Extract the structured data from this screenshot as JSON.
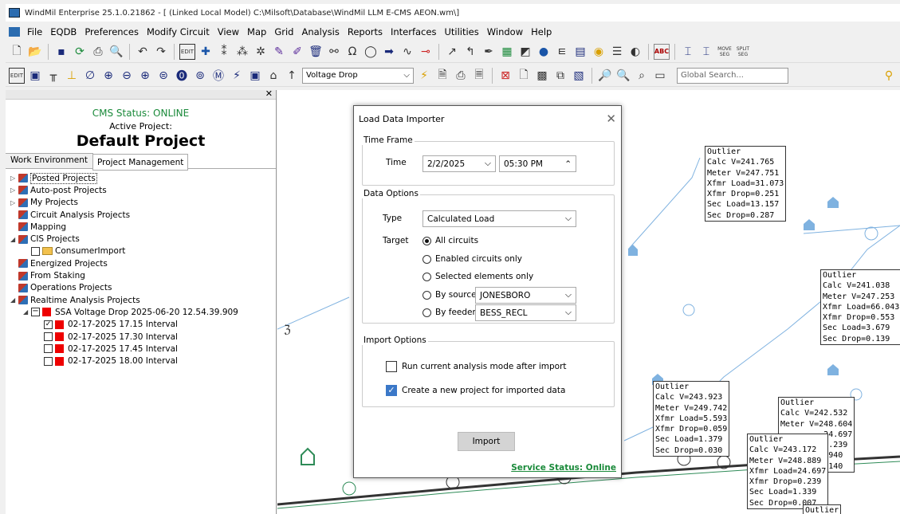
{
  "window": {
    "title": "WindMil Enterprise 25.1.0.21862 - [ (Linked Local Model) C:\\Milsoft\\Database\\WindMil LLM E-CMS AEON.wm\\]"
  },
  "menu": [
    "File",
    "EQDB",
    "Preferences",
    "Modify Circuit",
    "View",
    "Map",
    "Grid",
    "Analysis",
    "Reports",
    "Interfaces",
    "Utilities",
    "Window",
    "Help"
  ],
  "toolbar": {
    "mode_select": "Voltage Drop",
    "global_search_placeholder": "Global Search...",
    "edit_label": "EDIT",
    "move_label": "MOVE SEG",
    "split_label": "SPLIT SEG",
    "abc_label": "ABC"
  },
  "sidebar": {
    "status": "CMS Status: ONLINE",
    "active_label": "Active Project:",
    "project_name": "Default Project",
    "tabs": [
      "Work Environment",
      "Project Management"
    ],
    "tree": [
      {
        "label": "Posted Projects",
        "exp": "▷",
        "icon": "mix",
        "indent": 0
      },
      {
        "label": "Auto-post Projects",
        "exp": "▷",
        "icon": "mix",
        "indent": 0
      },
      {
        "label": "My Projects",
        "exp": "▷",
        "icon": "mix",
        "indent": 0
      },
      {
        "label": "Circuit Analysis Projects",
        "exp": "",
        "icon": "mix",
        "indent": 0
      },
      {
        "label": "Mapping",
        "exp": "",
        "icon": "mix",
        "indent": 0
      },
      {
        "label": "CIS Projects",
        "exp": "◢",
        "icon": "mix",
        "indent": 0
      },
      {
        "label": "ConsumerImport",
        "exp": "",
        "icon": "folder",
        "indent": 1
      },
      {
        "label": "Energized Projects",
        "exp": "",
        "icon": "mix",
        "indent": 0
      },
      {
        "label": "From Staking",
        "exp": "",
        "icon": "mix",
        "indent": 0
      },
      {
        "label": "Operations Projects",
        "exp": "",
        "icon": "mix",
        "indent": 0
      },
      {
        "label": "Realtime Analysis Projects",
        "exp": "◢",
        "icon": "mix",
        "indent": 0
      },
      {
        "label": "SSA Voltage Drop 2025-06-20 12.54.39.909",
        "exp": "◢",
        "icon": "minus",
        "indent": 1
      },
      {
        "label": "02-17-2025 17.15 Interval",
        "exp": "",
        "icon": "checked",
        "indent": 2
      },
      {
        "label": "02-17-2025 17.30 Interval",
        "exp": "",
        "icon": "check",
        "indent": 2
      },
      {
        "label": "02-17-2025 17.45 Interval",
        "exp": "",
        "icon": "check",
        "indent": 2
      },
      {
        "label": "02-17-2025 18.00 Interval",
        "exp": "",
        "icon": "check",
        "indent": 2
      }
    ]
  },
  "dialog": {
    "title": "Load Data Importer",
    "time_frame": "Time Frame",
    "time_label": "Time",
    "date": "2/2/2025",
    "time": "05:30 PM",
    "data_options": "Data Options",
    "type_label": "Type",
    "type_value": "Calculated Load",
    "target_label": "Target",
    "targets": [
      "All circuits",
      "Enabled circuits only",
      "Selected elements only",
      "By source",
      "By feeder"
    ],
    "source_value": "JONESBORO",
    "feeder_value": "BESS_RECL",
    "import_options": "Import Options",
    "opt_run": "Run current analysis mode after import",
    "opt_create": "Create a new project for imported data",
    "import_button": "Import",
    "service_status": "Service Status: Online"
  },
  "map_boxes": [
    "Outlier\nCalc V=241.765\nMeter V=247.751\nXfmr Load=31.073\nXfmr Drop=0.251\nSec Load=13.157\nSec Drop=0.287",
    "Outlier\nCalc V=241.038\nMeter V=247.253\nXfmr Load=66.043\nXfmr Drop=0.553\nSec Load=3.679\nSec Drop=0.139",
    "Outlier\nCalc V=243.923\nMeter V=249.742\nXfmr Load=5.593\nXfmr Drop=0.059\nSec Load=1.379\nSec Drop=0.030",
    "Outlier\nCalc V=242.532\nMeter V=248.604\n         24.697\n         0.239\n         .940\n         .140",
    "Outlier\nCalc V=243.172\nMeter V=248.889\nXfmr Load=24.697\nXfmr Drop=0.239\nSec Load=1.339\nSec Drop=0.007",
    "Outlier"
  ]
}
